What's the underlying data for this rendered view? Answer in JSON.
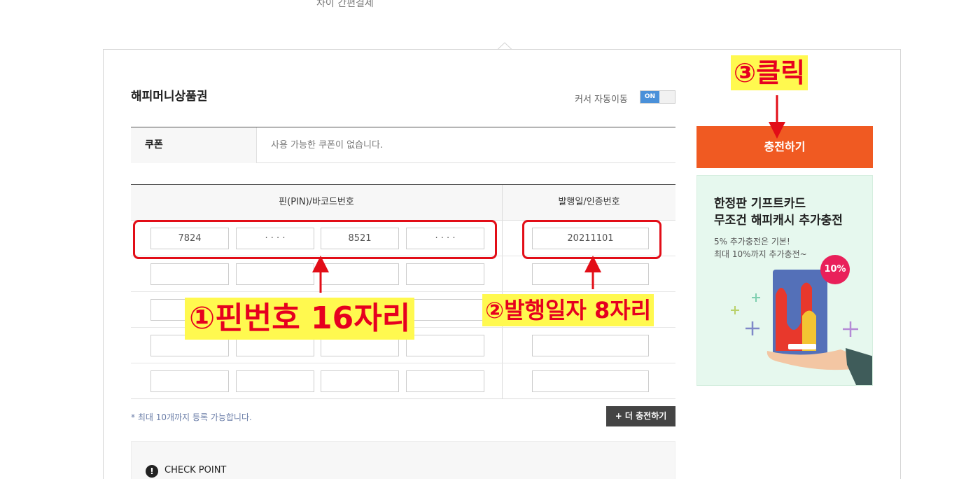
{
  "header": {
    "tab_label": "차이 간편결제"
  },
  "card": {
    "title": "해피머니상품권",
    "cursor_auto_label": "커서 자동이동",
    "toggle_label": "ON"
  },
  "coupon": {
    "label": "쿠폰",
    "text": "사용 가능한 쿠폰이 없습니다."
  },
  "pin_table": {
    "pin_header": "핀(PIN)/바코드번호",
    "date_header": "발행일/인증번호",
    "rows": [
      {
        "pins": [
          "7824",
          "· · · ·",
          "8521",
          "· · · ·"
        ],
        "date": "20211101"
      },
      {
        "pins": [
          "",
          "",
          "",
          ""
        ],
        "date": ""
      },
      {
        "pins": [
          "",
          "",
          "",
          ""
        ],
        "date": ""
      },
      {
        "pins": [
          "",
          "",
          "",
          ""
        ],
        "date": ""
      },
      {
        "pins": [
          "",
          "",
          "",
          ""
        ],
        "date": ""
      }
    ]
  },
  "note": "* 최대 10개까지 등록 가능합니다.",
  "more_button": "+ 더 충전하기",
  "check_point": {
    "icon": "!",
    "label": "CHECK POINT"
  },
  "charge_button": "충전하기",
  "banner": {
    "title_line1": "한정판 기프트카드",
    "title_line2": "무조건 해피캐시 추가충전",
    "sub_line1": "5% 추가충전은 기본!",
    "sub_line2": "최대 10%까지 추가충전~",
    "badge": "10%"
  },
  "annotations": {
    "step1": "①핀번호 16자리",
    "step2": "②발행일자 8자리",
    "step3": "③클릭"
  },
  "colors": {
    "charge_button": "#f05a22",
    "annotation_text": "#e6001f",
    "annotation_bg": "#fff94f",
    "banner_bg": "#e6f8ee"
  }
}
